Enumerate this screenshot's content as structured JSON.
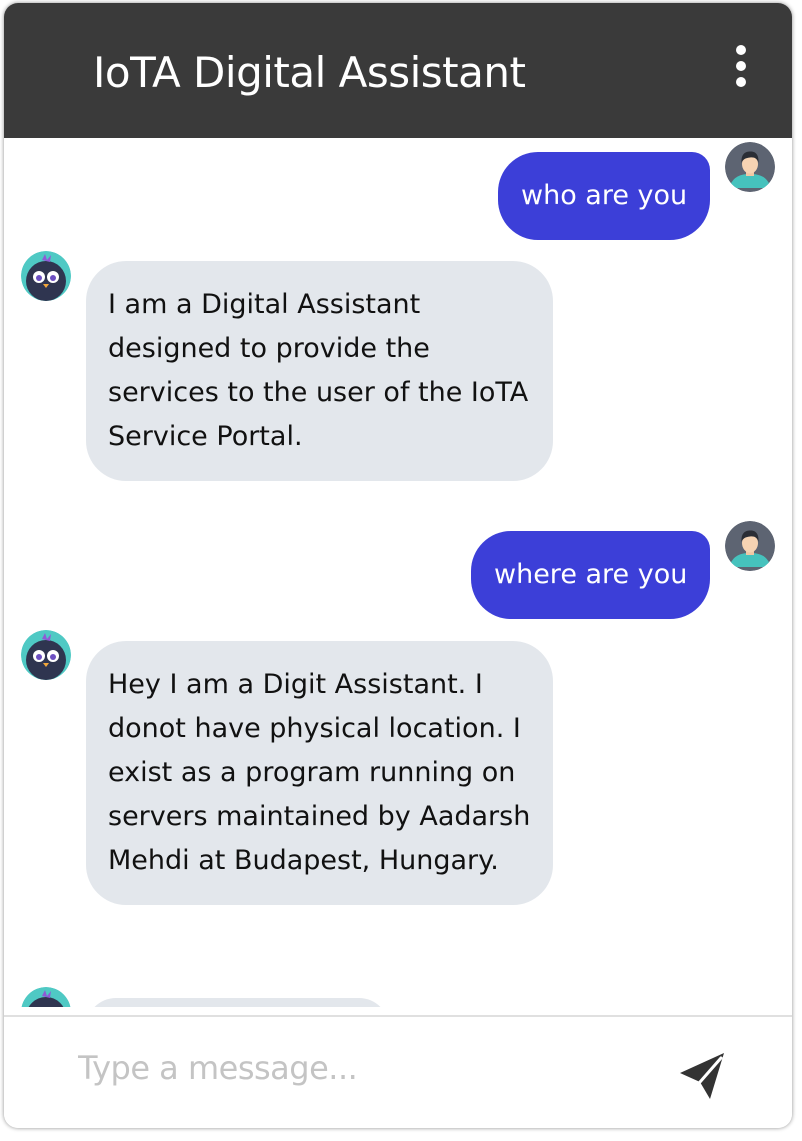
{
  "header": {
    "title": "IoTA Digital Assistant",
    "menu_icon": "vertical-dots-icon"
  },
  "messages": [
    {
      "sender": "user",
      "text": "who are you"
    },
    {
      "sender": "bot",
      "text": "I am a Digital Assistant designed to provide the services to the user of the IoTA Service Portal."
    },
    {
      "sender": "user",
      "text": "where are you"
    },
    {
      "sender": "bot",
      "text": "Hey I am a Digit Assistant. I donot have physical location. I exist as a program running on servers maintained by Aadarsh Mehdi at Budapest, Hungary."
    },
    {
      "sender": "bot",
      "text": ""
    }
  ],
  "composer": {
    "placeholder": "Type a message...",
    "send_icon": "paper-plane-icon"
  },
  "colors": {
    "header_bg": "#3a3a3a",
    "user_bubble": "#3c3fd8",
    "bot_bubble": "#e3e7ec",
    "avatar_teal": "#4fc9c4"
  }
}
